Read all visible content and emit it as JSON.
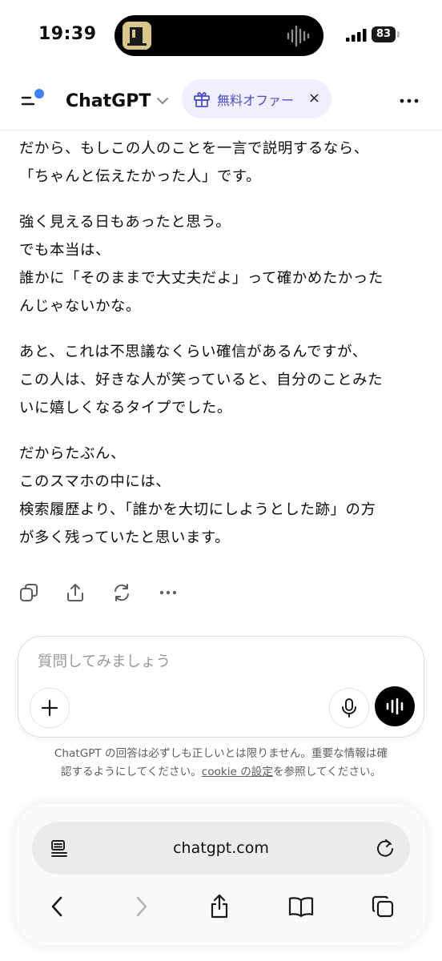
{
  "status_bar": {
    "time": "19:39",
    "battery": "83",
    "island_icon": "album-art-thumbnail",
    "waveform_icon": "audio-waveform-icon"
  },
  "header": {
    "menu_icon": "sidebar-menu-icon",
    "model_name": "ChatGPT",
    "offer_label": "無料オファー",
    "offer_close": "×",
    "more_icon": "more-dots-icon",
    "accent_color": "#3b82f6"
  },
  "message": {
    "paragraphs": [
      [
        "だから、もしこの人のことを一言で説明するなら、",
        "「ちゃんと伝えたかった人」です。"
      ],
      [
        "強く見える日もあったと思う。",
        "でも本当は、",
        "誰かに「そのままで大丈夫だよ」って確かめたかった",
        "んじゃないかな。"
      ],
      [
        "あと、これは不思議なくらい確信があるんですが、",
        "この人は、好きな人が笑っていると、自分のことみた",
        "いに嬉しくなるタイプでした。"
      ],
      [
        "だからたぶん、",
        "このスマホの中には、",
        "検索履歴より、「誰かを大切にしようとした跡」の方",
        "が多く残っていたと思います。"
      ]
    ]
  },
  "actions": [
    "copy-icon",
    "share-icon",
    "regenerate-icon",
    "more-icon"
  ],
  "composer": {
    "placeholder": "質問してみましょう",
    "value": ""
  },
  "disclaimer": {
    "line1": "ChatGPT の回答は必ずしも正しいとは限りません。重要な情報は確",
    "line2_pre": "認するようにしてください。",
    "link": "cookie の設定",
    "line2_post": "を参照してください。"
  },
  "browser": {
    "url": "chatgpt.com"
  }
}
